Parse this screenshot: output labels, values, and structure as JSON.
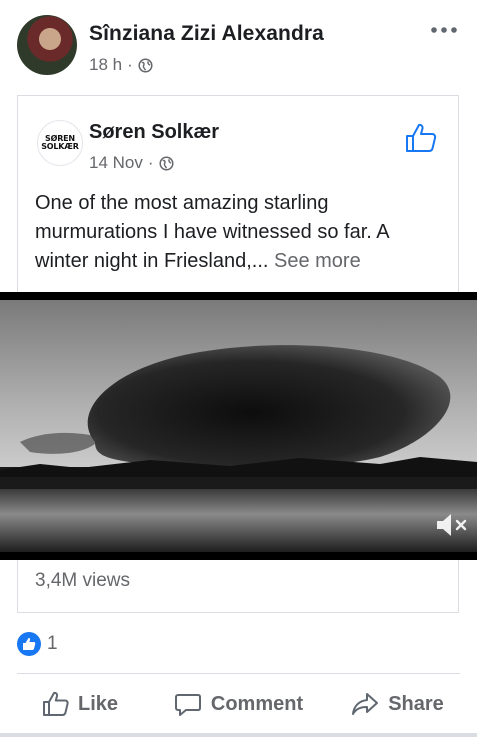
{
  "post": {
    "author": "Sînziana Zizi Alexandra",
    "time": "18 h",
    "separator": "·",
    "privacy_icon": "globe-icon",
    "more_icon": "more-horizontal-icon"
  },
  "shared": {
    "page_name": "Søren Solkær",
    "page_logo_lines": [
      "SØREN",
      "SOLKÆR"
    ],
    "date": "14 Nov",
    "separator": "·",
    "caption": "One of the most amazing starling murmurations I have witnessed so far. A winter night in Friesland,...",
    "see_more": "See more",
    "views": "3,4M views"
  },
  "video": {
    "muted": true,
    "mute_icon": "speaker-muted-icon"
  },
  "reactions": {
    "icon": "like-reaction-icon",
    "count": "1"
  },
  "actions": {
    "like": "Like",
    "comment": "Comment",
    "share": "Share"
  },
  "colors": {
    "facebook_blue": "#1877f2",
    "secondary_text": "#65676b",
    "divider": "#dadde1"
  }
}
